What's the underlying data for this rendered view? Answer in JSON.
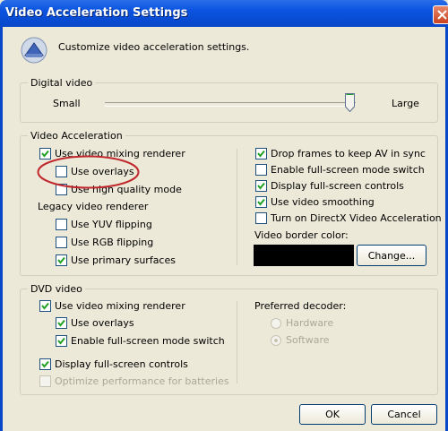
{
  "window": {
    "title": "Video Acceleration Settings",
    "header_text": "Customize video acceleration settings.",
    "accent_color": "#0a53e0"
  },
  "digital_video": {
    "group_label": "Digital video",
    "slider_min_label": "Small",
    "slider_max_label": "Large",
    "slider_level": 0.96
  },
  "video_acceleration": {
    "group_label": "Video Acceleration",
    "use_vmr": {
      "label": "Use video mixing renderer",
      "checked": true
    },
    "use_overlays": {
      "label": "Use overlays",
      "checked": false
    },
    "use_high_quality_mode": {
      "label": "Use high quality mode",
      "checked": false
    },
    "legacy_label": "Legacy video renderer",
    "use_yuv_flipping": {
      "label": "Use YUV flipping",
      "checked": false
    },
    "use_rgb_flipping": {
      "label": "Use RGB flipping",
      "checked": false
    },
    "use_primary_surfaces": {
      "label": "Use primary surfaces",
      "checked": true
    },
    "drop_frames": {
      "label": "Drop frames to keep AV in sync",
      "checked": true
    },
    "enable_fullscreen_switch": {
      "label": "Enable full-screen mode switch",
      "checked": false
    },
    "display_fullscreen_controls": {
      "label": "Display full-screen controls",
      "checked": true
    },
    "use_video_smoothing": {
      "label": "Use video smoothing",
      "checked": true
    },
    "directx_acceleration": {
      "label": "Turn on DirectX Video Acceleration",
      "checked": false
    },
    "border_color_label": "Video border color:",
    "border_color": "#000000",
    "change_button": "Change..."
  },
  "dvd_video": {
    "group_label": "DVD video",
    "use_vmr": {
      "label": "Use video mixing renderer",
      "checked": true
    },
    "use_overlays": {
      "label": "Use overlays",
      "checked": true
    },
    "enable_fullscreen_switch": {
      "label": "Enable full-screen mode switch",
      "checked": true
    },
    "display_fullscreen_controls": {
      "label": "Display full-screen controls",
      "checked": true
    },
    "optimize_batteries": {
      "label": "Optimize performance for batteries",
      "checked": false
    },
    "preferred_decoder_label": "Preferred decoder:",
    "hardware": {
      "label": "Hardware",
      "selected": false
    },
    "software": {
      "label": "Software",
      "selected": true
    }
  },
  "buttons": {
    "ok": "OK",
    "cancel": "Cancel"
  },
  "annotation_color": "#c0282d"
}
